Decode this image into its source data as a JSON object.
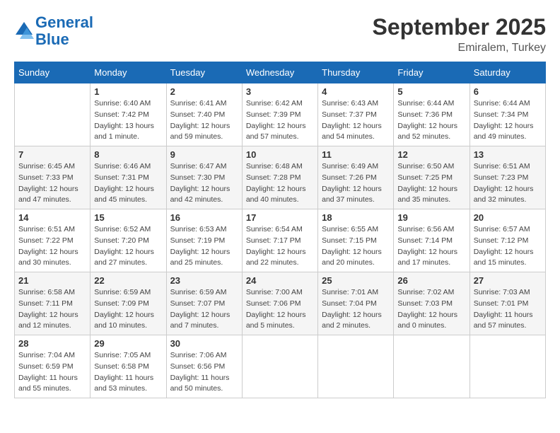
{
  "header": {
    "logo_line1": "General",
    "logo_line2": "Blue",
    "month": "September 2025",
    "location": "Emiralem, Turkey"
  },
  "weekdays": [
    "Sunday",
    "Monday",
    "Tuesday",
    "Wednesday",
    "Thursday",
    "Friday",
    "Saturday"
  ],
  "weeks": [
    [
      {
        "day": "",
        "info": ""
      },
      {
        "day": "1",
        "info": "Sunrise: 6:40 AM\nSunset: 7:42 PM\nDaylight: 13 hours\nand 1 minute."
      },
      {
        "day": "2",
        "info": "Sunrise: 6:41 AM\nSunset: 7:40 PM\nDaylight: 12 hours\nand 59 minutes."
      },
      {
        "day": "3",
        "info": "Sunrise: 6:42 AM\nSunset: 7:39 PM\nDaylight: 12 hours\nand 57 minutes."
      },
      {
        "day": "4",
        "info": "Sunrise: 6:43 AM\nSunset: 7:37 PM\nDaylight: 12 hours\nand 54 minutes."
      },
      {
        "day": "5",
        "info": "Sunrise: 6:44 AM\nSunset: 7:36 PM\nDaylight: 12 hours\nand 52 minutes."
      },
      {
        "day": "6",
        "info": "Sunrise: 6:44 AM\nSunset: 7:34 PM\nDaylight: 12 hours\nand 49 minutes."
      }
    ],
    [
      {
        "day": "7",
        "info": "Sunrise: 6:45 AM\nSunset: 7:33 PM\nDaylight: 12 hours\nand 47 minutes."
      },
      {
        "day": "8",
        "info": "Sunrise: 6:46 AM\nSunset: 7:31 PM\nDaylight: 12 hours\nand 45 minutes."
      },
      {
        "day": "9",
        "info": "Sunrise: 6:47 AM\nSunset: 7:30 PM\nDaylight: 12 hours\nand 42 minutes."
      },
      {
        "day": "10",
        "info": "Sunrise: 6:48 AM\nSunset: 7:28 PM\nDaylight: 12 hours\nand 40 minutes."
      },
      {
        "day": "11",
        "info": "Sunrise: 6:49 AM\nSunset: 7:26 PM\nDaylight: 12 hours\nand 37 minutes."
      },
      {
        "day": "12",
        "info": "Sunrise: 6:50 AM\nSunset: 7:25 PM\nDaylight: 12 hours\nand 35 minutes."
      },
      {
        "day": "13",
        "info": "Sunrise: 6:51 AM\nSunset: 7:23 PM\nDaylight: 12 hours\nand 32 minutes."
      }
    ],
    [
      {
        "day": "14",
        "info": "Sunrise: 6:51 AM\nSunset: 7:22 PM\nDaylight: 12 hours\nand 30 minutes."
      },
      {
        "day": "15",
        "info": "Sunrise: 6:52 AM\nSunset: 7:20 PM\nDaylight: 12 hours\nand 27 minutes."
      },
      {
        "day": "16",
        "info": "Sunrise: 6:53 AM\nSunset: 7:19 PM\nDaylight: 12 hours\nand 25 minutes."
      },
      {
        "day": "17",
        "info": "Sunrise: 6:54 AM\nSunset: 7:17 PM\nDaylight: 12 hours\nand 22 minutes."
      },
      {
        "day": "18",
        "info": "Sunrise: 6:55 AM\nSunset: 7:15 PM\nDaylight: 12 hours\nand 20 minutes."
      },
      {
        "day": "19",
        "info": "Sunrise: 6:56 AM\nSunset: 7:14 PM\nDaylight: 12 hours\nand 17 minutes."
      },
      {
        "day": "20",
        "info": "Sunrise: 6:57 AM\nSunset: 7:12 PM\nDaylight: 12 hours\nand 15 minutes."
      }
    ],
    [
      {
        "day": "21",
        "info": "Sunrise: 6:58 AM\nSunset: 7:11 PM\nDaylight: 12 hours\nand 12 minutes."
      },
      {
        "day": "22",
        "info": "Sunrise: 6:59 AM\nSunset: 7:09 PM\nDaylight: 12 hours\nand 10 minutes."
      },
      {
        "day": "23",
        "info": "Sunrise: 6:59 AM\nSunset: 7:07 PM\nDaylight: 12 hours\nand 7 minutes."
      },
      {
        "day": "24",
        "info": "Sunrise: 7:00 AM\nSunset: 7:06 PM\nDaylight: 12 hours\nand 5 minutes."
      },
      {
        "day": "25",
        "info": "Sunrise: 7:01 AM\nSunset: 7:04 PM\nDaylight: 12 hours\nand 2 minutes."
      },
      {
        "day": "26",
        "info": "Sunrise: 7:02 AM\nSunset: 7:03 PM\nDaylight: 12 hours\nand 0 minutes."
      },
      {
        "day": "27",
        "info": "Sunrise: 7:03 AM\nSunset: 7:01 PM\nDaylight: 11 hours\nand 57 minutes."
      }
    ],
    [
      {
        "day": "28",
        "info": "Sunrise: 7:04 AM\nSunset: 6:59 PM\nDaylight: 11 hours\nand 55 minutes."
      },
      {
        "day": "29",
        "info": "Sunrise: 7:05 AM\nSunset: 6:58 PM\nDaylight: 11 hours\nand 53 minutes."
      },
      {
        "day": "30",
        "info": "Sunrise: 7:06 AM\nSunset: 6:56 PM\nDaylight: 11 hours\nand 50 minutes."
      },
      {
        "day": "",
        "info": ""
      },
      {
        "day": "",
        "info": ""
      },
      {
        "day": "",
        "info": ""
      },
      {
        "day": "",
        "info": ""
      }
    ]
  ]
}
